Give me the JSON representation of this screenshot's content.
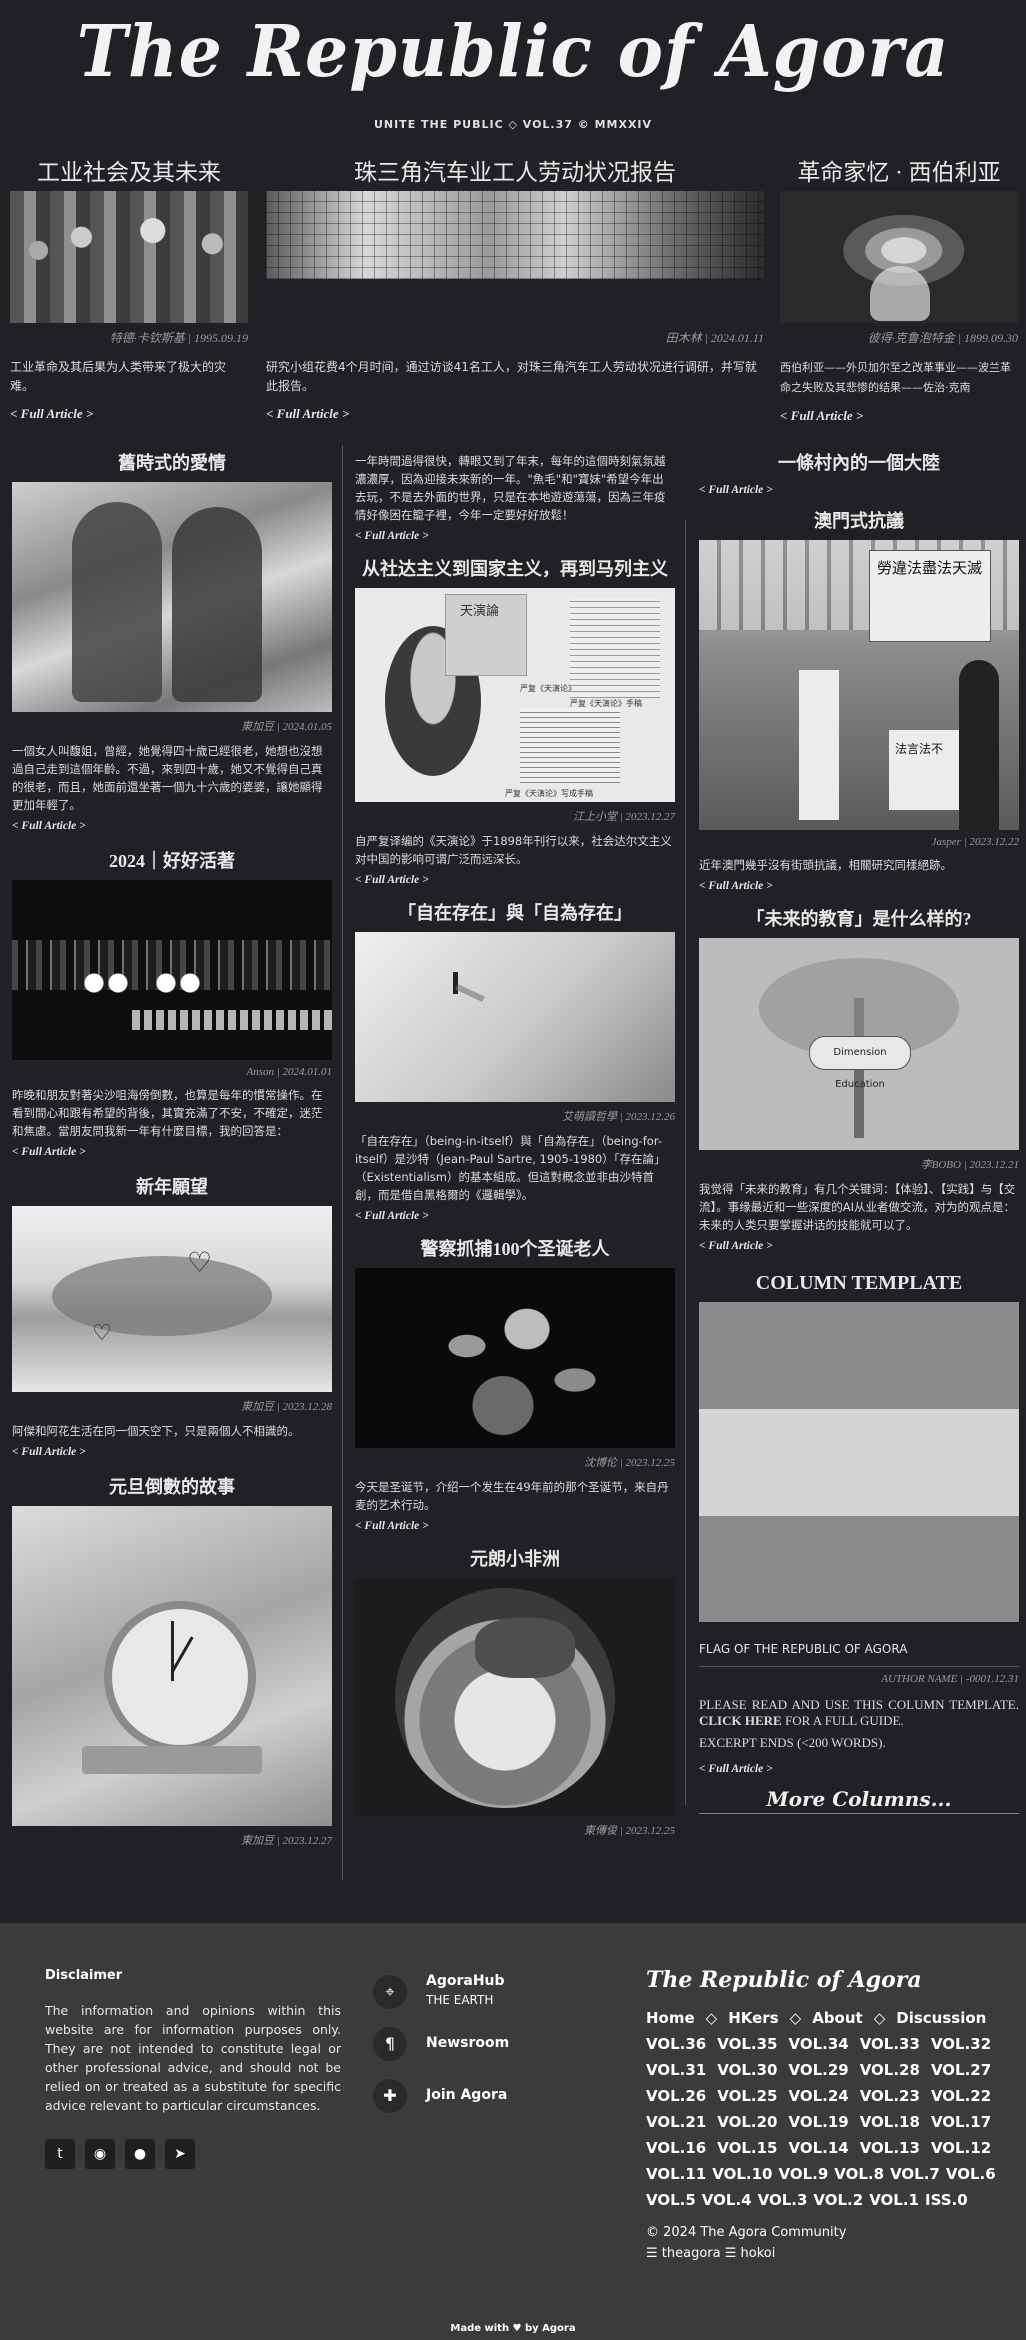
{
  "masthead": {
    "title": "The Republic of Agora",
    "tagline": "UNITE THE PUBLIC ◇ VOL.37 © MMXXIV"
  },
  "top": [
    {
      "title": "工业社会及其未来",
      "byline": "特德·卡钦斯基 | 1995.09.19",
      "desc": "工业革命及其后果为人类带来了极大的灾难。",
      "more": "< Full Article >"
    },
    {
      "title": "珠三角汽车业工人劳动状况报告",
      "byline": "田木林 | 2024.01.11",
      "desc": "研究小组花费4个月时间，通过访谈41名工人，对珠三角汽车工人劳动状况进行调研，并写就此报告。",
      "more": "< Full Article >"
    },
    {
      "title": "革命家忆 · 西伯利亚",
      "byline": "彼得·克鲁泡特金 | 1899.09.30",
      "desc": "西伯利亚——外贝加尔至之改革事业——波兰革命之失败及其悲惨的结果——佐治·克南",
      "more": "< Full Article >"
    }
  ],
  "left": [
    {
      "title": "舊時式的愛情",
      "byline": "東加豆 | 2024.01.05",
      "desc": "一個女人叫馥姐，曾經，她覺得四十歲已經很老，她想也沒想過自己走到這個年齡。不過，來到四十歲，她又不覺得自己真的很老，而且，她面前還坐著一個九十六歲的婆婆，讓她顯得更加年輕了。",
      "more": "< Full Article >"
    },
    {
      "title": "2024｜好好活著",
      "byline": "Anson | 2024.01.01",
      "desc": "昨晚和朋友對著尖沙咀海傍倒數，也算是每年的慣常操作。在看到間心和跟有希望的背後，其實充滿了不安，不確定，迷茫和焦慮。當朋友問我新一年有什麼目標，我的回答是：",
      "more": "< Full Article >"
    },
    {
      "title": "新年願望",
      "byline": "東加豆 | 2023.12.28",
      "desc": "阿傑和阿花生活在同一個天空下，只是兩個人不相識的。",
      "more": "< Full Article >"
    },
    {
      "title": "元旦倒數的故事",
      "byline": "東加豆 | 2023.12.27"
    }
  ],
  "middle": [
    {
      "desc": "一年時間過得很快，轉眼又到了年末，每年的這個時刻氣氛越濃濃厚，因為迎接未來新的一年。\"魚毛\"和\"寶妹\"希望今年出去玩，不是去外面的世界，只是在本地遊遊蕩蕩，因為三年疫情好像困在籠子裡，今年一定要好好放鬆！",
      "more": "< Full Article >"
    },
    {
      "title": "从社达主义到国家主义，再到马列主义",
      "byline": "江上小堂 | 2023.12.27",
      "desc": "自严复译编的《天演论》于1898年刊行以来，社会达尔文主义对中国的影响可谓广泛而远深长。",
      "more": "< Full Article >",
      "img_labels": [
        "天演論",
        "严复《天演论》手稿",
        "严复《天演论》",
        "严复《天演论》写成手稿"
      ]
    },
    {
      "title": "「自在存在」與「自為存在」",
      "byline": "艾萌讀哲學 | 2023.12.26",
      "desc": "「自在存在」（being-in-itself）與「自為存在」（being-for-itself）是沙特（Jean-Paul Sartre, 1905-1980）「存在論」（Existentialism）的基本組成。但這對概念並非由沙特首創，而是借自黑格爾的《邏輯學》。",
      "more": "< Full Article >"
    },
    {
      "title": "警察抓捕100个圣诞老人",
      "byline": "沈博伦 | 2023.12.25",
      "desc": "今天是圣诞节，介绍一个发生在49年前的那个圣诞节，来自丹麦的艺术行动。",
      "more": "< Full Article >"
    },
    {
      "title": "元朗小非洲",
      "byline": "東傳俊 | 2023.12.25"
    }
  ],
  "right": [
    {
      "title": "一條村內的一個大陸",
      "more": "< Full Article >"
    },
    {
      "title": "澳門式抗議",
      "byline": "Jasper | 2023.12.22",
      "desc": "近年澳門幾乎沒有街頭抗議，相關研究同樣絕跡。",
      "more": "< Full Article >",
      "img_labels": [
        "勞違法盡法天滅",
        "法言法不"
      ]
    },
    {
      "title": "「未来的教育」是什么样的?",
      "byline": "李BOBO | 2023.12.21",
      "desc": "我觉得「未来的教育」有几个关键词：【体验】、【实践】与【交流】。事缘最近和一些深度的AI从业者做交流，对为的观点是：未来的人类只要掌握讲话的技能就可以了。",
      "more": "< Full Article >",
      "img_label": "Dimension Education"
    },
    {
      "title": "COLUMN TEMPLATE",
      "caption": "FLAG OF THE REPUBLIC OF AGORA",
      "byline": "AUTHOR NAME | -0001.12.31",
      "desc_a": "PLEASE READ AND USE THIS COLUMN TEMPLATE.",
      "desc_b": "CLICK HERE",
      "desc_c": "FOR A FULL GUIDE.",
      "desc_d": "EXCERPT ENDS (<200 WORDS).",
      "more": "< Full Article >"
    }
  ],
  "more_columns": "More Columns...",
  "footer": {
    "disclaimer_title": "Disclaimer",
    "disclaimer_text": "The information and opinions within this website are for information purposes only. They are not intended to constitute legal or other professional advice, and should not be relied on or treated as a substitute for specific advice relevant to particular circumstances.",
    "links": [
      {
        "label": "AgoraHub",
        "sub": "THE EARTH",
        "icon": "location-icon"
      },
      {
        "label": "Newsroom",
        "sub": "",
        "icon": "paragraph-icon"
      },
      {
        "label": "Join Agora",
        "sub": "",
        "icon": "puzzle-icon"
      }
    ],
    "brand": "The Republic of Agora",
    "nav": [
      "Home",
      "HKers",
      "About",
      "Discussion"
    ],
    "nav_sep": "◇",
    "volumes": [
      [
        "VOL.36",
        "VOL.35",
        "VOL.34",
        "VOL.33",
        "VOL.32"
      ],
      [
        "VOL.31",
        "VOL.30",
        "VOL.29",
        "VOL.28",
        "VOL.27"
      ],
      [
        "VOL.26",
        "VOL.25",
        "VOL.24",
        "VOL.23",
        "VOL.22"
      ],
      [
        "VOL.21",
        "VOL.20",
        "VOL.19",
        "VOL.18",
        "VOL.17"
      ],
      [
        "VOL.16",
        "VOL.15",
        "VOL.14",
        "VOL.13",
        "VOL.12"
      ],
      [
        "VOL.11",
        "VOL.10",
        "VOL.9",
        "VOL.8",
        "VOL.7",
        "VOL.6"
      ],
      [
        "VOL.5",
        "VOL.4",
        "VOL.3",
        "VOL.2",
        "VOL.1",
        "ISS.0"
      ]
    ],
    "copyright": "© 2024 The Agora Community",
    "credits": "☰ theagora ☰ hokoi",
    "made_with": "Made with ♥ by Agora",
    "socials": [
      "twitter-icon",
      "github-icon",
      "reddit-icon",
      "telegram-icon"
    ]
  }
}
